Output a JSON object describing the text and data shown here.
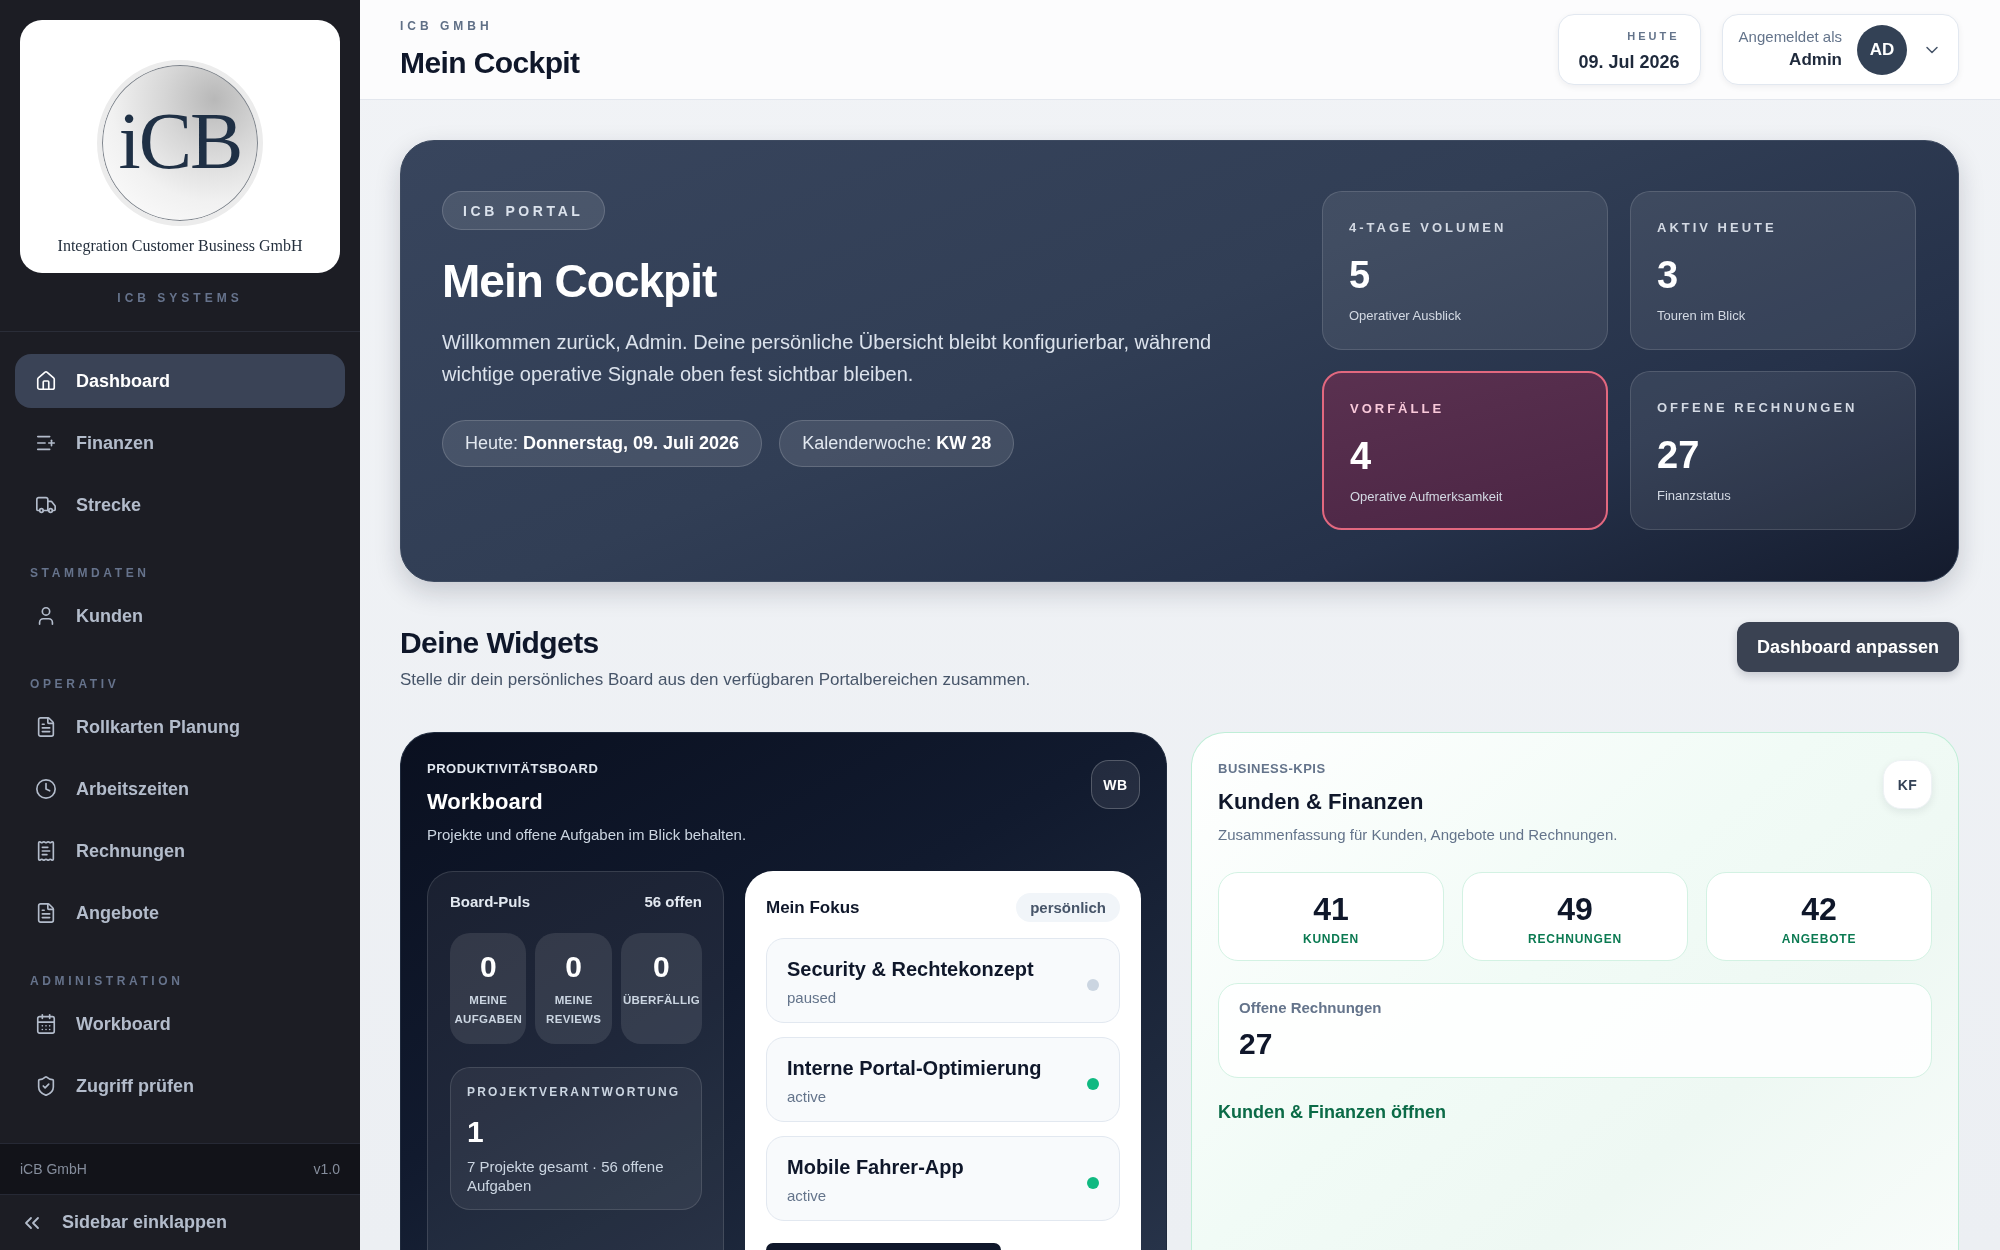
{
  "sidebar": {
    "logo": {
      "mark": "iCB",
      "company": "Integration Customer Business GmbH"
    },
    "caption": "ICB SYSTEMS",
    "nav_groups": [
      {
        "items": [
          {
            "label": "Dashboard",
            "selected": true
          },
          {
            "label": "Finanzen",
            "selected": false
          },
          {
            "label": "Strecke",
            "selected": false
          }
        ]
      },
      {
        "heading": "STAMMDATEN",
        "items": [
          {
            "label": "Kunden",
            "selected": false
          }
        ]
      },
      {
        "heading": "OPERATIV",
        "items": [
          {
            "label": "Rollkarten Planung",
            "selected": false
          },
          {
            "label": "Arbeitszeiten",
            "selected": false
          },
          {
            "label": "Rechnungen",
            "selected": false
          },
          {
            "label": "Angebote",
            "selected": false
          }
        ]
      },
      {
        "heading": "ADMINISTRATION",
        "items": [
          {
            "label": "Workboard",
            "selected": false
          },
          {
            "label": "Zugriff prüfen",
            "selected": false
          }
        ]
      }
    ],
    "footer": {
      "company": "iCB GmbH",
      "version": "v1.0"
    },
    "collapse_button": "Sidebar einklappen"
  },
  "header": {
    "overline": "ICB GMBH",
    "title": "Mein Cockpit",
    "date_card": {
      "label": "HEUTE",
      "value": "09. Jul 2026"
    },
    "user_menu": {
      "label": "Angemeldet als",
      "name": "Admin",
      "initials": "AD"
    }
  },
  "hero": {
    "badge": "ICB PORTAL",
    "title": "Mein Cockpit",
    "text": "Willkommen zurück, Admin. Deine persönliche Übersicht bleibt konfigurierbar, während wichtige operative Signale oben fest sichtbar bleiben.",
    "chips": [
      "Heute: **Donnerstag, 09. Juli 2026**",
      "Kalenderwoche: **KW 28**"
    ],
    "stats": [
      {
        "label": "4-TAGE VOLUMEN",
        "value": "5",
        "caption": "Operativer Ausblick",
        "alert": false
      },
      {
        "label": "AKTIV HEUTE",
        "value": "3",
        "caption": "Touren im Blick",
        "alert": false
      },
      {
        "label": "VORFÄLLE",
        "value": "4",
        "caption": "Operative Aufmerksamkeit",
        "alert": true
      },
      {
        "label": "OFFENE RECHNUNGEN",
        "value": "27",
        "caption": "Finanzstatus",
        "alert": false
      }
    ]
  },
  "widgets_section": {
    "title": "Deine Widgets",
    "subtitle": "Stelle dir dein persönliches Board aus den verfügbaren Portalbereichen zusammen.",
    "button": "Dashboard anpassen"
  },
  "workboard_widget": {
    "overline": "PRODUKTIVITÄTSBOARD",
    "title": "Workboard",
    "description": "Projekte und offene Aufgaben im Blick behalten.",
    "badge": "WB",
    "board_pulse": {
      "title": "Board-Puls",
      "open_count": "56 offen",
      "tiles": [
        {
          "value": "0",
          "label": "MEINE AUFGABEN"
        },
        {
          "value": "0",
          "label": "MEINE REVIEWS"
        },
        {
          "value": "0",
          "label": "ÜBERFÄLLIG"
        }
      ],
      "responsibility": {
        "label": "PROJEKTVERANTWORTUNG",
        "value": "1",
        "caption": "7 Projekte gesamt · 56 offene Aufgaben"
      }
    },
    "focus": {
      "title": "Mein Fokus",
      "tag": "persönlich",
      "items": [
        {
          "title": "Security & Rechtekonzept",
          "status": "paused",
          "color": "#cbd5e1"
        },
        {
          "title": "Interne Portal-Optimierung",
          "status": "active",
          "color": "#10b981"
        },
        {
          "title": "Mobile Fahrer-App",
          "status": "active",
          "color": "#10b981"
        }
      ]
    }
  },
  "kpi_widget": {
    "overline": "BUSINESS-KPIS",
    "title": "Kunden & Finanzen",
    "description": "Zusammenfassung für Kunden, Angebote und Rechnungen.",
    "badge": "KF",
    "tiles": [
      {
        "value": "41",
        "label": "KUNDEN"
      },
      {
        "value": "49",
        "label": "RECHNUNGEN"
      },
      {
        "value": "42",
        "label": "ANGEBOTE"
      }
    ],
    "open_invoices": {
      "label": "Offene Rechnungen",
      "value": "27"
    },
    "link": "Kunden & Finanzen öffnen"
  }
}
